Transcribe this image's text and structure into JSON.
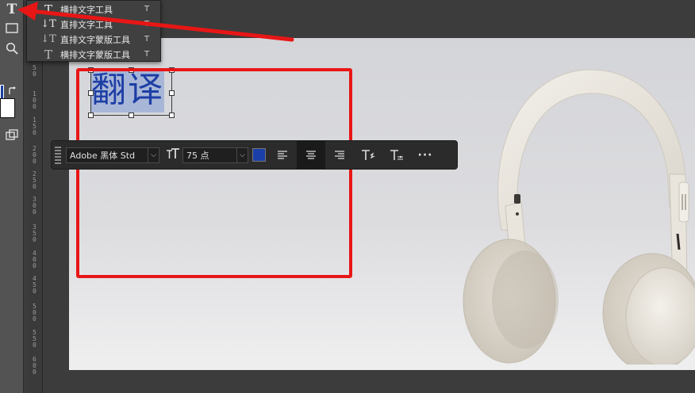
{
  "toolbar": {
    "tools": [
      {
        "name": "type-tool",
        "glyph": "T"
      },
      {
        "name": "rectangle-tool",
        "glyph": "▭"
      },
      {
        "name": "zoom-tool",
        "glyph": "⌕"
      },
      {
        "name": "swap-colors",
        "glyph": "⤿"
      },
      {
        "name": "screen-mode",
        "glyph": "⧉"
      }
    ],
    "foreground_color": "#1b3fa0",
    "background_color": "#ffffff"
  },
  "flyout": {
    "items": [
      {
        "icon": "T",
        "label": "横排文字工具",
        "shortcut": "T",
        "selected": true
      },
      {
        "icon": "↓T",
        "label": "直排文字工具",
        "shortcut": "T",
        "selected": false
      },
      {
        "icon": "↓T",
        "label": "直排文字蒙版工具",
        "shortcut": "T",
        "selected": false
      },
      {
        "icon": "T",
        "label": "横排文字蒙版工具",
        "shortcut": "T",
        "selected": false
      }
    ]
  },
  "ruler": {
    "labels": [
      "50",
      "100",
      "150",
      "200",
      "250",
      "300",
      "350",
      "400",
      "450",
      "500",
      "550",
      "600"
    ]
  },
  "canvas": {
    "text_layer": "翻译",
    "text_color": "#1d3ea5"
  },
  "taskbar": {
    "font_family": "Adobe 黑体 Std",
    "font_size": "75 点",
    "text_color": "#1a3fa8",
    "more_label": "···"
  },
  "annotation": {
    "highlight_color": "#e81616"
  }
}
